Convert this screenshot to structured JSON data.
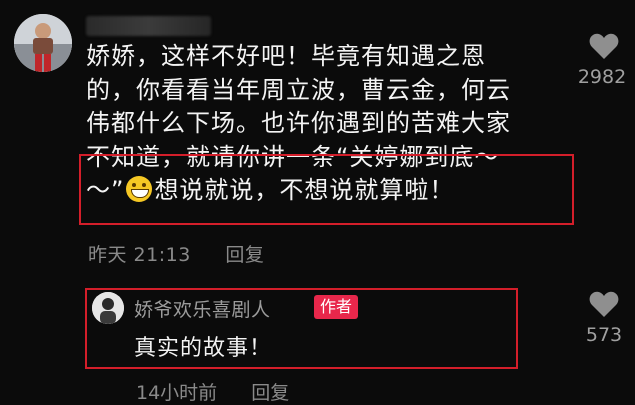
{
  "comment": {
    "lines": [
      "娇娇，这样不好吧！毕竟有知遇之恩",
      "的，你看看当年周立波，曹云金，何云",
      "伟都什么下场。也许你遇到的苦难大家",
      "不知道，就请你讲一条“关婷娜到底～"
    ],
    "line5_before": "～”",
    "line5_after": "想说就说，不想说就算啦！",
    "emoji": "grinning-face",
    "time": "昨天 21:13",
    "reply_label": "回复",
    "like_count": "2982"
  },
  "reply": {
    "username": "娇爷欢乐喜剧人",
    "badge": "作者",
    "text": "真实的故事！",
    "time": "14小时前",
    "reply_label": "回复",
    "like_count": "573"
  },
  "colors": {
    "background": "#0b0b0b",
    "highlight_border": "#d41e2a",
    "author_badge": "#e8274b"
  }
}
